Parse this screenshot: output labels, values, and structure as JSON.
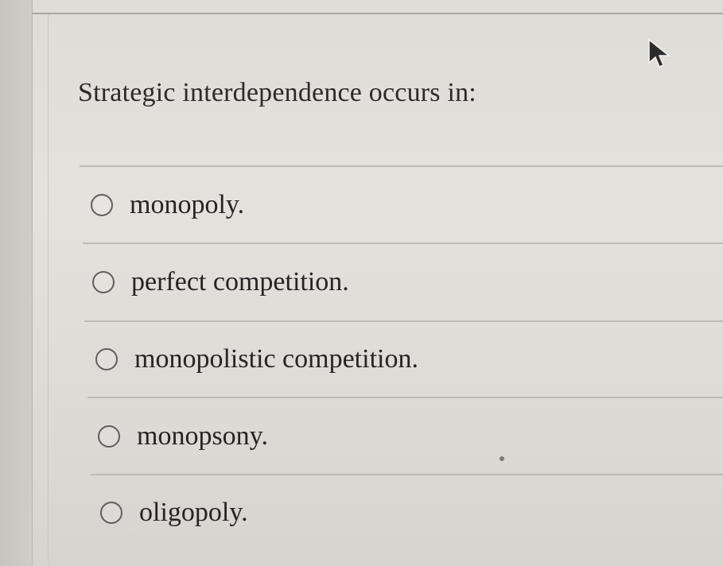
{
  "question": {
    "text": "Strategic interdependence occurs in:"
  },
  "options": [
    {
      "label": "monopoly.",
      "selected": false
    },
    {
      "label": "perfect competition.",
      "selected": false
    },
    {
      "label": "monopolistic competition.",
      "selected": false
    },
    {
      "label": "monopsony.",
      "selected": false
    },
    {
      "label": "oligopoly.",
      "selected": false
    }
  ],
  "cursor": {
    "icon": "mouse-pointer-icon"
  }
}
